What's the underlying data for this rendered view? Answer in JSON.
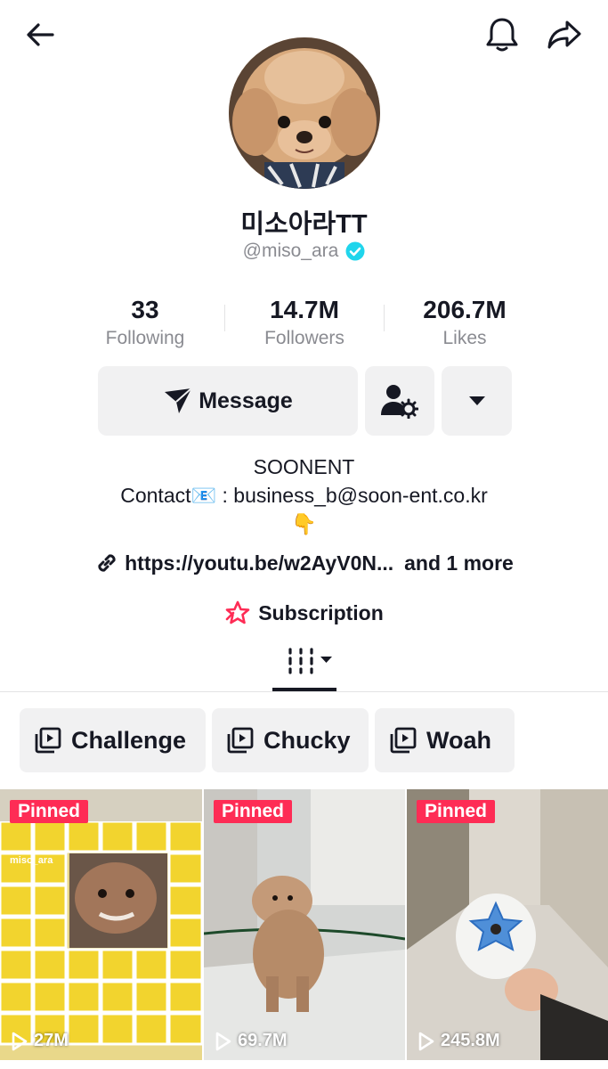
{
  "profile": {
    "display_name": "미소아라TT",
    "username": "@miso_ara",
    "verified": true
  },
  "stats": [
    {
      "value": "33",
      "label": "Following"
    },
    {
      "value": "14.7M",
      "label": "Followers"
    },
    {
      "value": "206.7M",
      "label": "Likes"
    }
  ],
  "actions": {
    "message_label": "Message"
  },
  "bio": {
    "line1": "SOONENT",
    "line2": "Contact📧 : business_b@soon-ent.co.kr",
    "line3": "👇"
  },
  "link": {
    "url": "https://youtu.be/w2AyV0N...",
    "more": "and 1 more"
  },
  "subscription_label": "Subscription",
  "playlists": [
    {
      "label": "Challenge"
    },
    {
      "label": "Chucky"
    },
    {
      "label": "Woah"
    }
  ],
  "videos": [
    {
      "badge": "Pinned",
      "views": "27M",
      "watermark": "miso_ara"
    },
    {
      "badge": "Pinned",
      "views": "69.7M"
    },
    {
      "badge": "Pinned",
      "views": "245.8M"
    }
  ],
  "colors": {
    "accent": "#fe2c55",
    "verified": "#20d5ec",
    "button_bg": "#f1f1f2",
    "secondary_text": "#8a8b91"
  }
}
